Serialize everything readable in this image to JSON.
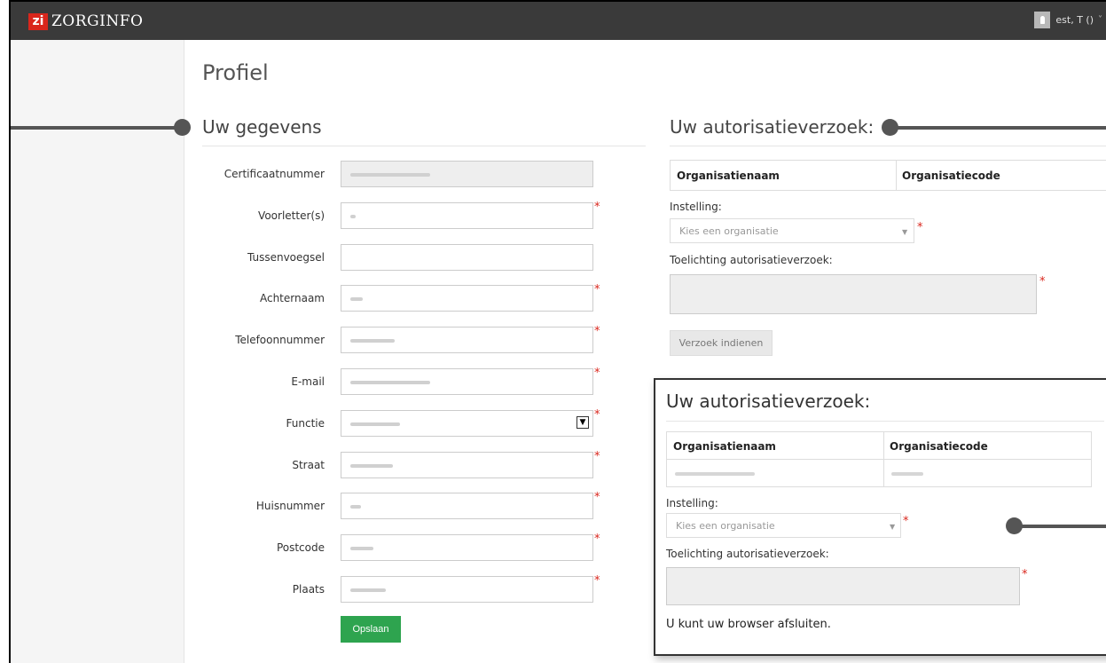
{
  "header": {
    "logo_mark": "zi",
    "logo_text": "ZORGINFO",
    "user_name": "est, T ()",
    "user_caret": "˅"
  },
  "page_title": "Profiel",
  "left_section": {
    "title": "Uw gegevens",
    "fields": [
      {
        "label": "Certificaatnummer",
        "readonly": true,
        "required": false
      },
      {
        "label": "Voorletter(s)",
        "required": true
      },
      {
        "label": "Tussenvoegsel",
        "required": false
      },
      {
        "label": "Achternaam",
        "required": true
      },
      {
        "label": "Telefoonnummer",
        "required": true
      },
      {
        "label": "E-mail",
        "required": true
      },
      {
        "label": "Functie",
        "required": true,
        "type": "select"
      },
      {
        "label": "Straat",
        "required": true
      },
      {
        "label": "Huisnummer",
        "required": true
      },
      {
        "label": "Postcode",
        "required": true
      },
      {
        "label": "Plaats",
        "required": true
      }
    ],
    "save_label": "Opslaan",
    "required_mark": "*"
  },
  "right_section": {
    "title": "Uw autorisatieverzoek:",
    "col_org_name": "Organisatienaam",
    "col_org_code": "Organisatiecode",
    "instelling_label": "Instelling:",
    "instelling_placeholder": "Kies een organisatie",
    "toelichting_label": "Toelichting autorisatieverzoek:",
    "submit_label": "Verzoek indienen"
  },
  "overlay": {
    "title": "Uw autorisatieverzoek:",
    "col_org_name": "Organisatienaam",
    "col_org_code": "Organisatiecode",
    "instelling_label": "Instelling:",
    "instelling_placeholder": "Kies een organisatie",
    "toelichting_label": "Toelichting autorisatieverzoek:",
    "final_message": "U kunt uw browser afsluiten."
  },
  "colors": {
    "topbar": "#3a3a3a",
    "brand_red": "#d9261c",
    "save_green": "#2ea44f",
    "callout": "#555555"
  }
}
